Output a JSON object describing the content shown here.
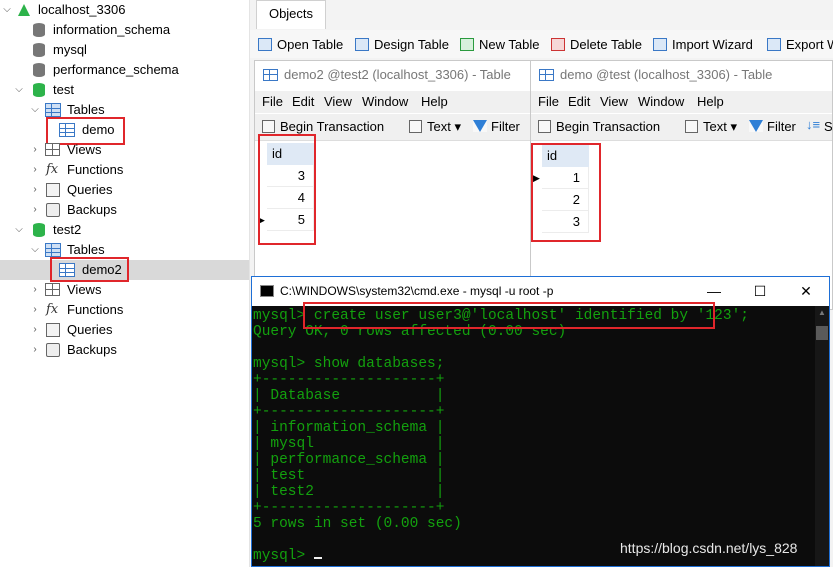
{
  "tree": {
    "connection": "localhost_3306",
    "databases_top": [
      "information_schema",
      "mysql",
      "performance_schema"
    ],
    "test": {
      "name": "test",
      "tables_label": "Tables",
      "table": "demo",
      "children": [
        "Views",
        "Functions",
        "Queries",
        "Backups"
      ]
    },
    "test2": {
      "name": "test2",
      "tables_label": "Tables",
      "table": "demo2",
      "children": [
        "Views",
        "Functions",
        "Queries",
        "Backups"
      ]
    }
  },
  "main": {
    "tab": "Objects",
    "toolbar": [
      "Open Table",
      "Design Table",
      "New Table",
      "Delete Table",
      "Import Wizard",
      "Export W"
    ]
  },
  "win_demo2": {
    "title": "demo2 @test2 (localhost_3306) - Table",
    "menu": [
      "File",
      "Edit",
      "View",
      "Window",
      "Help"
    ],
    "begin": "Begin Transaction",
    "text": "Text",
    "filter": "Filter",
    "column": "id",
    "rows": [
      "3",
      "4",
      "5"
    ]
  },
  "win_demo": {
    "title": "demo @test (localhost_3306) - Table",
    "menu": [
      "File",
      "Edit",
      "View",
      "Window",
      "Help"
    ],
    "begin": "Begin Transaction",
    "text": "Text",
    "filter": "Filter",
    "sort": "Sc",
    "column": "id",
    "rows": [
      "1",
      "2",
      "3"
    ]
  },
  "cmd": {
    "title": "C:\\WINDOWS\\system32\\cmd.exe - mysql  -u root -p",
    "lines": [
      "mysql> create user user3@'localhost' identified by '123';",
      "Query OK, 0 rows affected (0.00 sec)",
      "",
      "mysql> show databases;",
      "+--------------------+",
      "| Database           |",
      "+--------------------+",
      "| information_schema |",
      "| mysql              |",
      "| performance_schema |",
      "| test               |",
      "| test2              |",
      "+--------------------+",
      "5 rows in set (0.00 sec)",
      "",
      "mysql> "
    ]
  },
  "watermark": "https://blog.csdn.net/lys_828"
}
